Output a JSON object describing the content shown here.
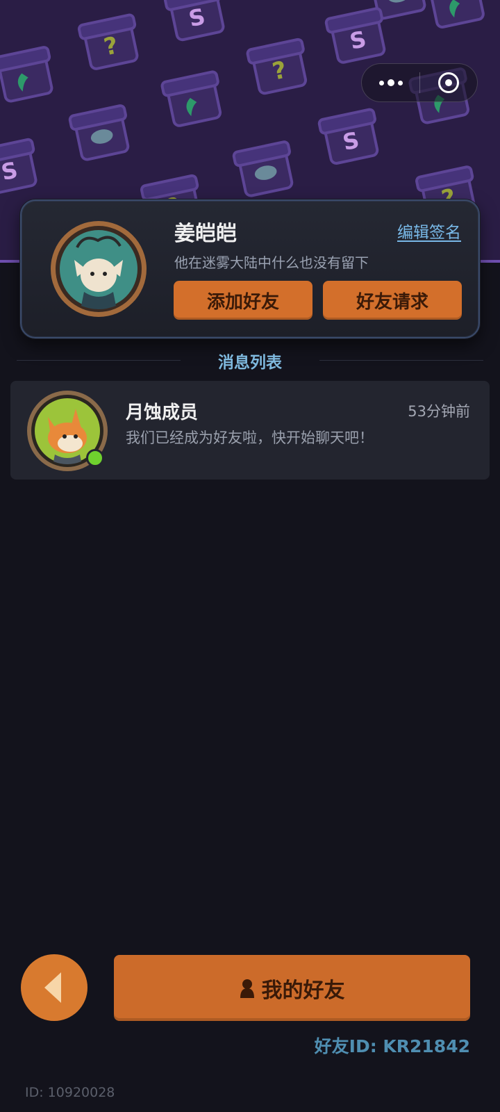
{
  "capsule": {
    "more_icon": "more-dots-icon",
    "close_icon": "target-close-icon"
  },
  "profile": {
    "name": "姜皑皑",
    "edit_signature_label": "编辑签名",
    "signature": "他在迷雾大陆中什么也没有留下",
    "add_friend_label": "添加好友",
    "friend_request_label": "好友请求"
  },
  "messages": {
    "section_title": "消息列表",
    "items": [
      {
        "name": "月蚀成员",
        "time": "53分钟前",
        "text": "我们已经成为好友啦，快开始聊天吧！",
        "online": true
      }
    ]
  },
  "bottom": {
    "my_friends_label": "我的好友",
    "friend_id": "好友ID: KR21842",
    "user_id": "ID: 10920028"
  },
  "colors": {
    "accent_orange": "#d36f2b",
    "link_blue": "#79b9e8",
    "online_green": "#6fd12e",
    "background": "#13131c"
  }
}
